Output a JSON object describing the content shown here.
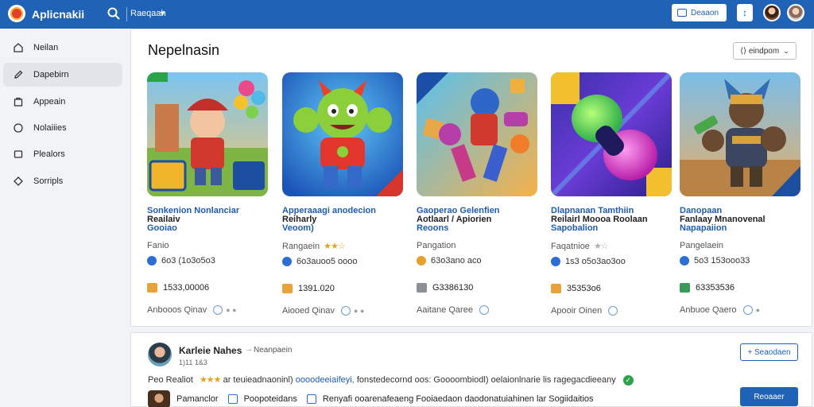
{
  "app": {
    "title": "Aplicnakii"
  },
  "search": {
    "label": "Raeqaah",
    "icon": "search-icon"
  },
  "topbar": {
    "button_label": "Deaaon",
    "pin_label": "↕"
  },
  "sidebar": {
    "items": [
      {
        "label": "Neilan",
        "icon": "home-icon"
      },
      {
        "label": "Dapebirn",
        "icon": "edit-icon",
        "active": true
      },
      {
        "label": "Appeain",
        "icon": "bag-icon"
      },
      {
        "label": "Nolaiiies",
        "icon": "circle-icon"
      },
      {
        "label": "Plealors",
        "icon": "tag-icon"
      },
      {
        "label": "Sorripls",
        "icon": "diamond-icon"
      }
    ]
  },
  "main": {
    "title": "Nepelnasin",
    "sort_label": "⟨⟩ eindpom",
    "games": [
      {
        "title1": "Sonkenion Nonlanciar",
        "title2": "Reailaiv",
        "title3": "Gooiao",
        "rating_label": "Fanio",
        "stars": "",
        "downloads": "6o3 (1o3o5o3",
        "size": "1533,00006",
        "action": "Anbooos Qinav"
      },
      {
        "title1": "Apperaaagi anodecion",
        "title2": "Reiharly",
        "title3": "Veoom)",
        "rating_label": "Rangaein",
        "stars": "★★☆",
        "downloads": "6o3auoo5 oooo",
        "size": "1391.020",
        "action": "Aiooed Qinav"
      },
      {
        "title1": "Gaoperao Gelenfien",
        "title2": "Aotlaarl / Apiorien",
        "title3": "Reoons",
        "rating_label": "Pangation",
        "stars": "",
        "downloads": "63o3ano aco",
        "size": "G3386130",
        "action": "Aaitane Qaree"
      },
      {
        "title1": "Dlapnanan Tamthiin",
        "title2": "Reilairl Moooa Roolaan",
        "title3": "Sapobalion",
        "rating_label": "Faqatnioe",
        "stars": "★☆",
        "downloads": "1s3 o5o3ao3oo",
        "size": "35353o6",
        "action": "Apooir Oinen"
      },
      {
        "title1": "Danopaan",
        "title2": "Fanlaay Mnanovenal",
        "title3": "Napapaiion",
        "rating_label": "Pangelaein",
        "stars": "",
        "downloads": "5o3 153ooo33",
        "size": "63353536",
        "action": "Anbuoe Qaero"
      }
    ]
  },
  "review": {
    "name": "Karleie Nahes",
    "arrow": "→",
    "tag": "Neanpaein",
    "date": "1)11 1&3",
    "text_start": "Peo Realiot",
    "stars": "★★★",
    "text_mid": "ar teuieadnaoninl)",
    "text_link": "oooodeeiaifeyi,",
    "text_end": "fonstedecornd oos: Goooombiodl) oelaionlnarie lis ragegacdieeany",
    "follow_label": "+ Seaodaen",
    "row2_name": "Pamanclor",
    "row2_item1": "Poopoteidans",
    "row2_item2": "Renyafi ooarenafeaeng Fooiaedaon daodonatuiahinen lar Sogiidaitios",
    "primary_label": "Reoaaer"
  }
}
